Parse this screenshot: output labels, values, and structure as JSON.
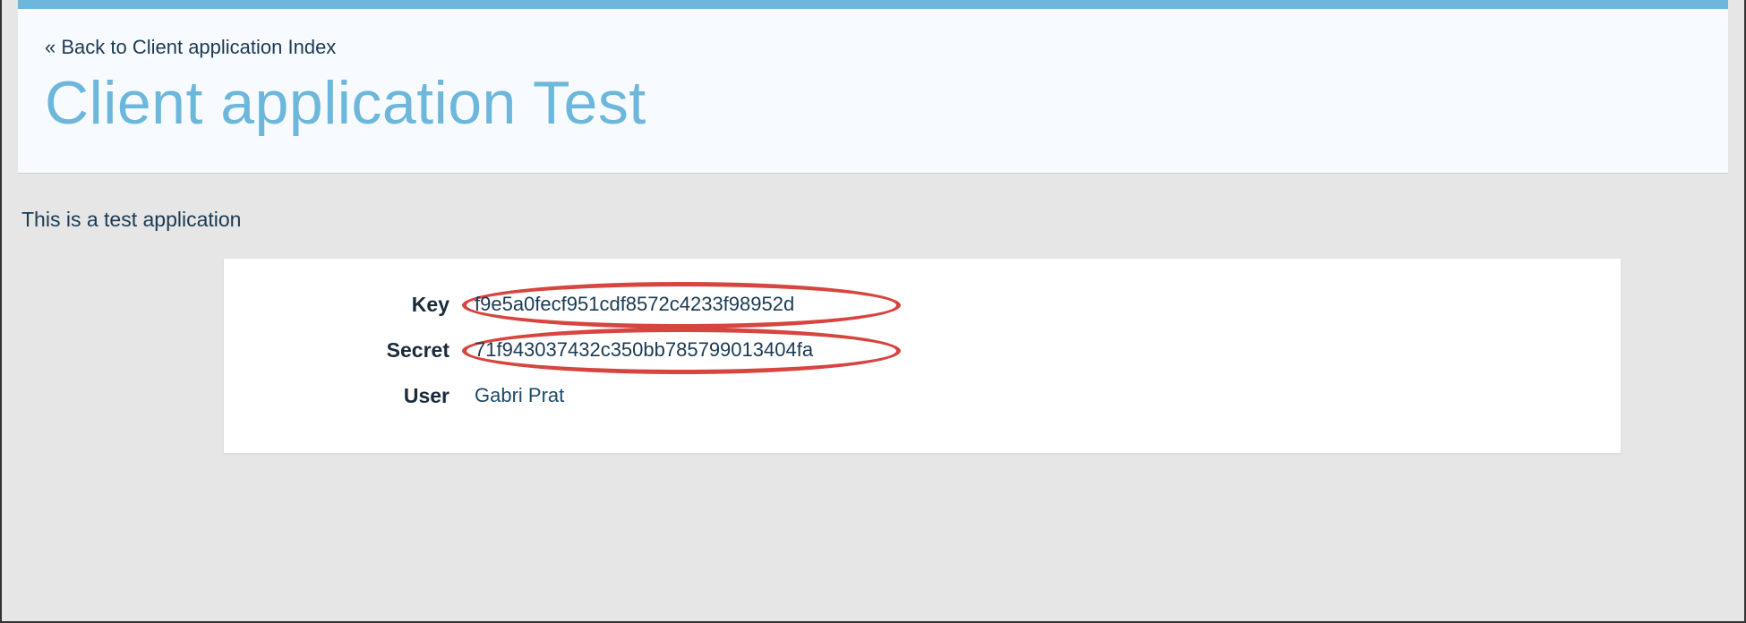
{
  "header": {
    "back_link": "« Back to Client application Index",
    "title": "Client application Test"
  },
  "description": "This is a test application",
  "details": {
    "key_label": "Key",
    "key_value": "f9e5a0fecf951cdf8572c4233f98952d",
    "secret_label": "Secret",
    "secret_value": "71f943037432c350bb785799013404fa",
    "user_label": "User",
    "user_value": "Gabri Prat"
  }
}
